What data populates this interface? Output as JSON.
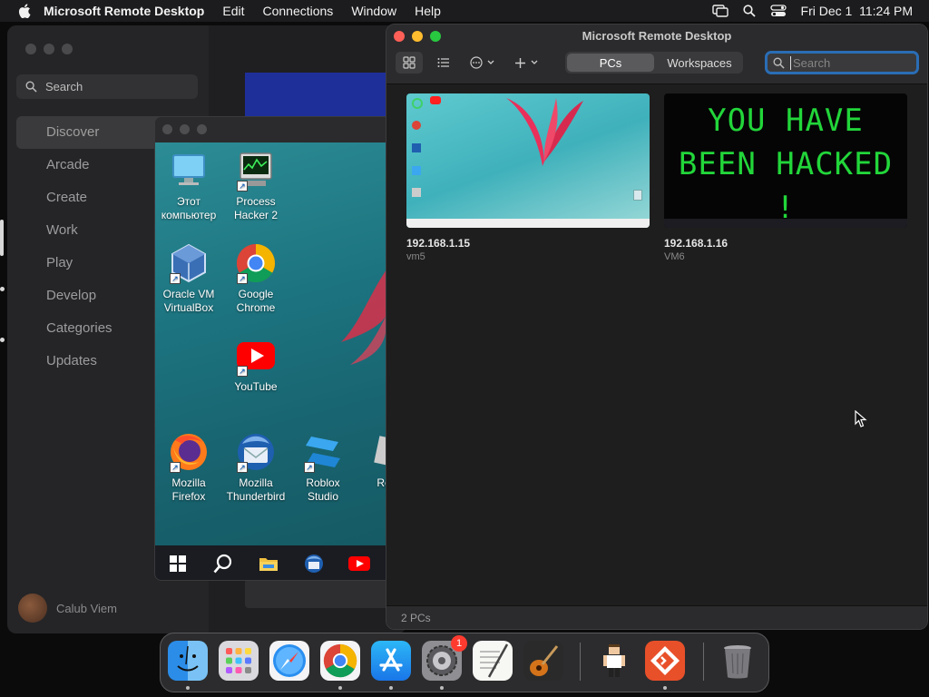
{
  "menubar": {
    "app_name": "Microsoft Remote Desktop",
    "menus": [
      "Edit",
      "Connections",
      "Window",
      "Help"
    ],
    "clock": "Fri Dec 1  11:24 PM"
  },
  "appstore": {
    "search_label": "Search",
    "nav": [
      "Discover",
      "Arcade",
      "Create",
      "Work",
      "Play",
      "Develop",
      "Categories",
      "Updates"
    ],
    "user_name": "Calub Viem"
  },
  "windows_session": {
    "icons": [
      {
        "label": "Этот компьютер",
        "icon": "this-pc-icon"
      },
      {
        "label": "Process Hacker 2",
        "icon": "process-hacker-icon"
      },
      {
        "label": "Oracle VM VirtualBox",
        "icon": "virtualbox-icon"
      },
      {
        "label": "Google Chrome",
        "icon": "chrome-icon"
      },
      {
        "label": "YouTube",
        "icon": "youtube-icon"
      },
      {
        "label": "Mozilla Firefox",
        "icon": "firefox-icon"
      },
      {
        "label": "Mozilla Thunderbird",
        "icon": "thunderbird-icon"
      },
      {
        "label": "Roblox Studio",
        "icon": "roblox-studio-icon"
      },
      {
        "label": "Ro Pl",
        "icon": "roblox-player-icon"
      }
    ]
  },
  "remote_desktop": {
    "title": "Microsoft Remote Desktop",
    "tabs": [
      "PCs",
      "Workspaces"
    ],
    "active_tab": "PCs",
    "search_placeholder": "Search",
    "pcs": [
      {
        "name": "192.168.1.15",
        "label": "vm5"
      },
      {
        "name": "192.168.1.16",
        "label": "VM6",
        "screen_text": "YOU HAVE BEEN HACKED !"
      }
    ],
    "status": "2 PCs"
  },
  "dock": {
    "items": [
      "Finder",
      "Launchpad",
      "Safari",
      "Google Chrome",
      "App Store",
      "System Settings",
      "TextEdit",
      "GarageBand",
      "Character",
      "Microsoft Remote Desktop",
      "Trash"
    ],
    "settings_badge": "1"
  },
  "colors": {
    "accent": "#2a6db5",
    "hacked_text": "#22d63a",
    "traffic_close": "#fe5f57",
    "traffic_min": "#febc2e",
    "traffic_max": "#28c840"
  }
}
